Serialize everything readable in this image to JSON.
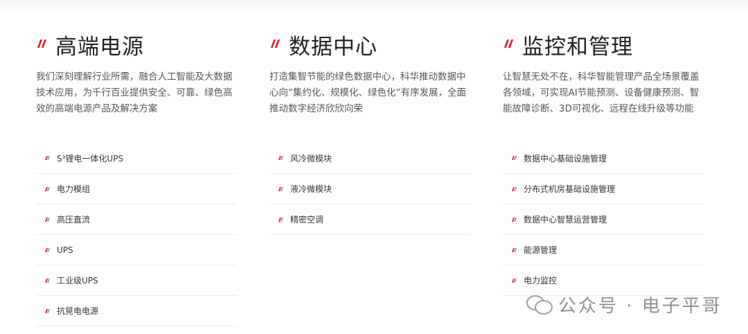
{
  "columns": [
    {
      "title": "高端电源",
      "description": "我们深刻理解行业所需，融合人工智能及大数据技术应用，为千行百业提供安全、可靠、绿色高效的高端电源产品及解决方案",
      "items": [
        "S³锂电一体化UPS",
        "电力模组",
        "高压直流",
        "UPS",
        "工业级UPS",
        "抗晃电电源"
      ]
    },
    {
      "title": "数据中心",
      "description": "打造集智节能的绿色数据中心，科华推动数据中心向“集约化、规模化、绿色化”有序发展，全面推动数字经济欣欣向荣",
      "items": [
        "风冷微模块",
        "液冷微模块",
        "精密空调"
      ]
    },
    {
      "title": "监控和管理",
      "description": "让智慧无处不在，科华智能管理产品全场景覆盖各领域，可实现AI节能预测、设备健康预测、智能故障诊断、3D可视化、远程在线升级等功能",
      "items": [
        "数据中心基础设施管理",
        "分布式机房基础设施管理",
        "数据中心智慧运营管理",
        "能源管理",
        "电力监控"
      ]
    }
  ],
  "watermark": {
    "icon": "wechat-icon",
    "text": "公众号 · 电子平哥"
  },
  "colors": {
    "accent": "#e0252b",
    "title": "#222222",
    "text": "#555555",
    "divider": "#ececec"
  }
}
